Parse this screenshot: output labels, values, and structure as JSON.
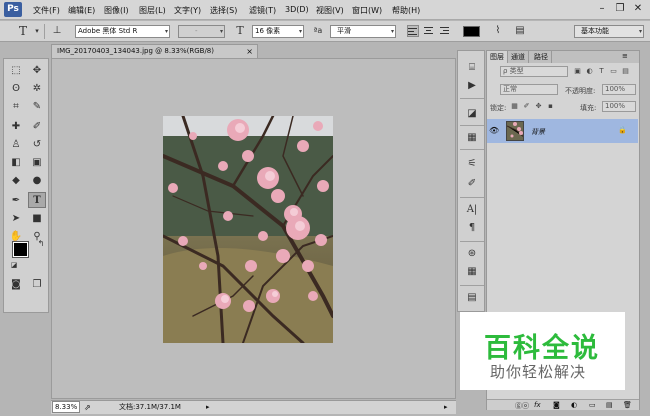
{
  "app": {
    "logo": "Ps"
  },
  "menu": [
    "文件(F)",
    "编辑(E)",
    "图像(I)",
    "图层(L)",
    "文字(Y)",
    "选择(S)",
    "滤镜(T)",
    "3D(D)",
    "视图(V)",
    "窗口(W)",
    "帮助(H)"
  ],
  "window_controls": {
    "minimize": "–",
    "restore": "❐",
    "close": "✕"
  },
  "options_bar": {
    "tool_icon": "T",
    "font_family": "Adobe 黑体 Std R",
    "font_style": "-",
    "font_size": "16 像素",
    "aa_icon": "ªa",
    "antialias": "平滑",
    "workspace": "基本功能",
    "text_color": "#000000"
  },
  "document": {
    "tab_title": "IMG_20170403_134043.jpg @ 8.33%(RGB/8)",
    "close_label": "×",
    "zoom": "8.33%",
    "doc_info": "文档:37.1M/37.1M"
  },
  "layers_panel": {
    "tabs": [
      "图层",
      "通道",
      "路径"
    ],
    "filter_type": "ρ 类型",
    "blend_mode": "正常",
    "opacity_label": "不透明度:",
    "opacity_value": "100%",
    "lock_label": "锁定:",
    "fill_label": "填充:",
    "fill_value": "100%",
    "layer_name": "背景",
    "lock_icon": "🔒",
    "bottom_icons": [
      "ⓖⓞ",
      "fx",
      "◙",
      "◐",
      "▭",
      "▤",
      "🗑"
    ]
  },
  "watermark": {
    "main": "百科全说",
    "sub": "助你轻松解决"
  },
  "colors": {
    "accent": "#3b5fa0",
    "layer_selected": "#9fb7e0",
    "watermark_green": "#2dbb3c"
  }
}
